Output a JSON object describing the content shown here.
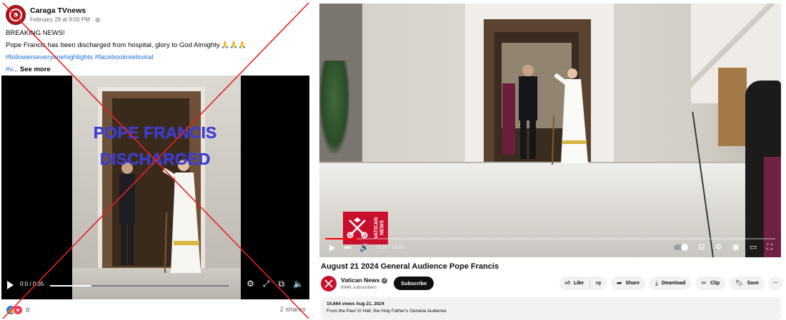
{
  "facebook": {
    "page_name": "Caraga TVnews",
    "timestamp": "February 28 at 9:00 PM · ",
    "more_label": "···",
    "post_line1": "BREAKING NEWS!",
    "post_line2": "Pope Francis has been discharged from hospital, glory to God Almighty.🙏🙏🙏",
    "hashtags": "#followerseveryonehighlights #facebookreelsviral",
    "hashtag_short": "#v",
    "see_more_prefix": "... ",
    "see_more": "See more",
    "video": {
      "overlay_line1": "POPE FRANCIS",
      "overlay_line2": "DISCHARGED",
      "time": "0:0 / 0:35",
      "progress": 0.23
    },
    "reactions_count": "8",
    "shares": "2 shares",
    "accent_color": "#1877f2"
  },
  "youtube": {
    "video": {
      "logo_text": "VATICAN NEWS",
      "time": "3:32 / 51:40",
      "progress": 0.07
    },
    "title": "August 21 2024 General Audience Pope Francis",
    "channel_name": "Vatican News",
    "subscribers": "894K subscribers",
    "subscribe_label": "Subscribe",
    "like_label": "Like",
    "share_label": "Share",
    "download_label": "Download",
    "clip_label": "Clip",
    "save_label": "Save",
    "more_label": "···",
    "views_date": "10,664 views  Aug 21, 2024",
    "description": "From the Paul VI Hall, the Holy Father's General Audience",
    "brand_color": "#c8102e"
  }
}
